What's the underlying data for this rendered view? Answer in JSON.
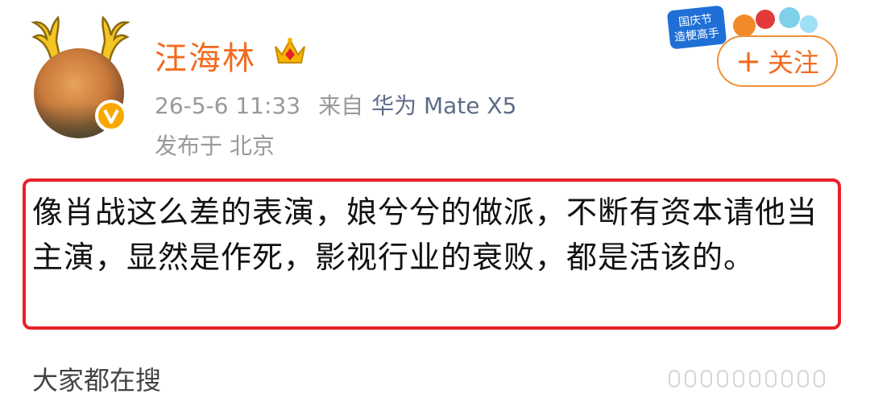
{
  "user": {
    "name": "汪海林",
    "verified_badge": "v-verified-icon",
    "crown_icon": "crown-icon"
  },
  "meta": {
    "time": "26-5-6 11:33",
    "from_label": "来自",
    "device": "华为 Mate X5",
    "location": "发布于 北京"
  },
  "follow": {
    "plus": "+",
    "label": "关注"
  },
  "campaign": {
    "line1": "国庆节",
    "line2": "造梗高手"
  },
  "post": {
    "text": "像肖战这么差的表演，娘兮兮的做派，不断有资本请他当主演，显然是作死，影视行业的衰败，都是活该的。"
  },
  "search": {
    "title": "大家都在搜"
  },
  "colors": {
    "username": "#f26b1f",
    "highlight_border": "#e8202a",
    "device_link": "#5f6c88",
    "meta_gray": "#999999"
  }
}
